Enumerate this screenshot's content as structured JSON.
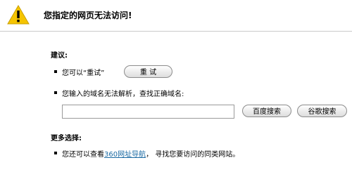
{
  "header": {
    "title": "您指定的网页无法访问!",
    "icon": "warning-icon"
  },
  "suggestions": {
    "heading": "建议:",
    "retry": {
      "text": "您可以“重试”",
      "button_label": "重 试"
    },
    "domain": {
      "text": "您输入的域名无法解析，查找正确域名:",
      "input_value": "",
      "baidu_button_label": "百度搜索",
      "google_button_label": "谷歌搜索"
    }
  },
  "more": {
    "heading": "更多选择:",
    "prefix": "您还可以查看",
    "link_label": "360网址导航",
    "suffix": "，  寻找您要访问的同类网站。"
  },
  "colors": {
    "warning_yellow": "#f5c400",
    "link": "#1a6aa3",
    "divider": "#c9c9c9"
  }
}
